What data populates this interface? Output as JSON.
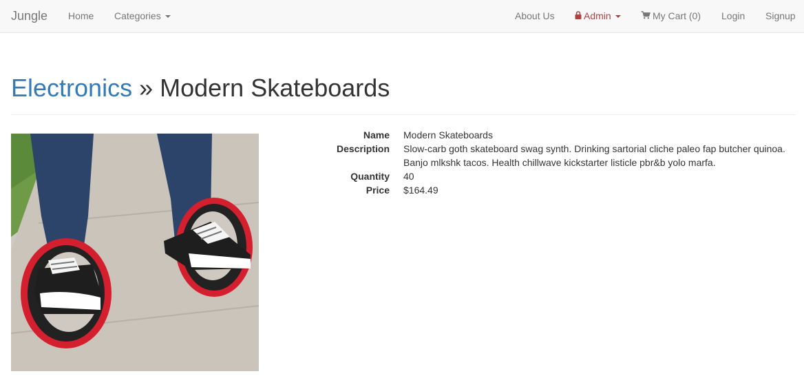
{
  "navbar": {
    "brand": "Jungle",
    "home": "Home",
    "categories": "Categories",
    "about": "About Us",
    "admin": "Admin",
    "cart": "My Cart (0)",
    "login": "Login",
    "signup": "Signup"
  },
  "icons": {
    "lock": "lock-icon",
    "cart": "shopping-cart-icon",
    "caret": "caret-down-icon"
  },
  "colors": {
    "link": "#337ab7",
    "admin": "#a94442",
    "navbar_bg": "#f8f8f8"
  },
  "page": {
    "category": "Electronics",
    "separator": "»",
    "title": "Modern Skateboards"
  },
  "product": {
    "labels": {
      "name": "Name",
      "description": "Description",
      "quantity": "Quantity",
      "price": "Price"
    },
    "name": "Modern Skateboards",
    "description": "Slow-carb goth skateboard swag synth. Drinking sartorial cliche paleo fap butcher quinoa. Banjo mlkshk tacos. Health chillwave kickstarter listicle pbr&b yolo marfa.",
    "quantity": "40",
    "price": "$164.49"
  }
}
